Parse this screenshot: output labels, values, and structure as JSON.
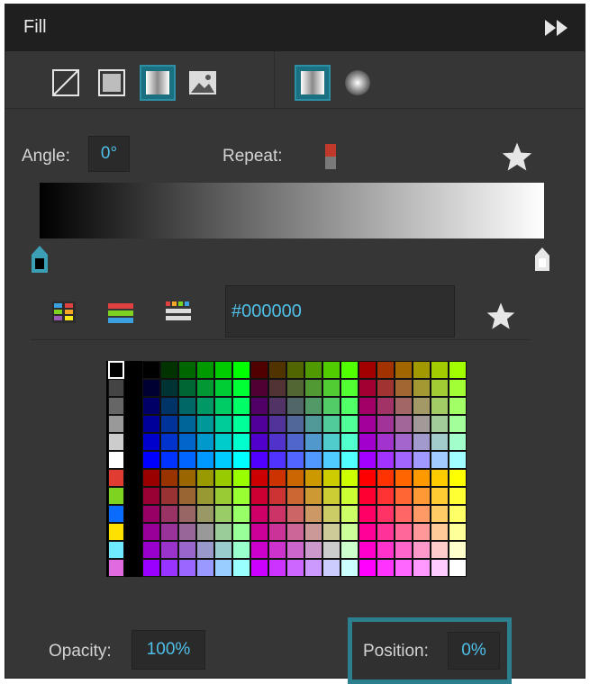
{
  "panel": {
    "title": "Fill",
    "icons": {
      "collapse": "double-chevron-right-icon",
      "fill_none": "no-fill-icon",
      "fill_solid": "solid-fill-icon",
      "fill_gradient": "gradient-fill-icon",
      "fill_image": "image-fill-icon",
      "gradient_linear": "linear-gradient-icon",
      "gradient_radial": "radial-gradient-icon",
      "favorite": "star-icon",
      "palette_grid": "palette-grid-icon",
      "palette_list": "palette-list-icon",
      "palette_custom": "palette-custom-icon"
    }
  },
  "gradient": {
    "angle_label": "Angle:",
    "angle_value": "0°",
    "repeat_label": "Repeat:",
    "start_color": "#000000",
    "end_color": "#ffffff"
  },
  "color": {
    "hex_value": "#000000"
  },
  "footer": {
    "opacity_label": "Opacity:",
    "opacity_value": "100%",
    "position_label": "Position:",
    "position_value": "0%"
  },
  "colors": {
    "accent": "#4fc0e8",
    "highlight_border": "#2c7f8f",
    "panel_bg": "#363636",
    "titlebar_bg": "#1f1f1f"
  },
  "swatches": {
    "left_column": [
      "#000000",
      "#444444",
      "#666666",
      "#999999",
      "#cccccc",
      "#ffffff",
      "#e03c31",
      "#7ed321",
      "#0a6cff",
      "#ffe100",
      "#6fe9ff",
      "#e06be0"
    ]
  }
}
